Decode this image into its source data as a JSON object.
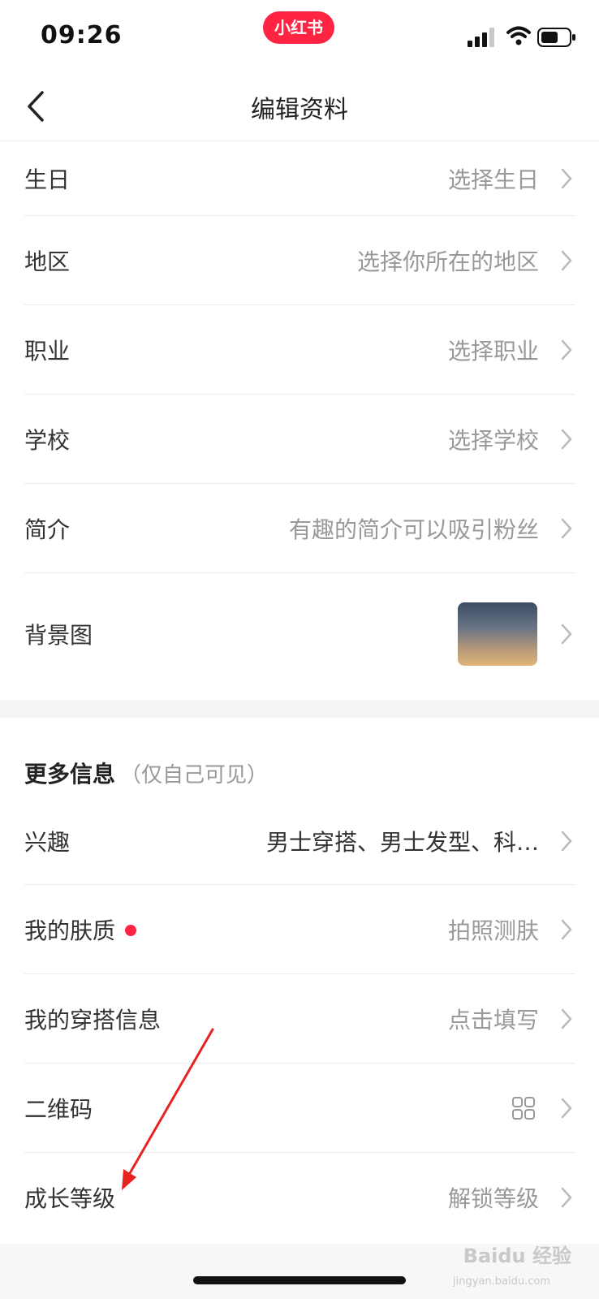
{
  "status_bar": {
    "time": "09:26",
    "app_badge": "小红书",
    "icons": [
      "signal-icon",
      "wifi-icon",
      "battery-icon"
    ]
  },
  "nav": {
    "title": "编辑资料",
    "back_icon": "back-icon"
  },
  "profile_rows": [
    {
      "label": "生日",
      "value": "选择生日"
    },
    {
      "label": "地区",
      "value": "选择你所在的地区"
    },
    {
      "label": "职业",
      "value": "选择职业"
    },
    {
      "label": "学校",
      "value": "选择学校"
    },
    {
      "label": "简介",
      "value": "有趣的简介可以吸引粉丝"
    },
    {
      "label": "背景图",
      "value": ""
    }
  ],
  "more_section": {
    "title": "更多信息",
    "note": "（仅自己可见）",
    "rows": [
      {
        "label": "兴趣",
        "value": "男士穿搭、男士发型、科…"
      },
      {
        "label": "我的肤质",
        "value": "拍照测肤",
        "has_red_dot": true
      },
      {
        "label": "我的穿搭信息",
        "value": "点击填写"
      },
      {
        "label": "二维码",
        "value": ""
      },
      {
        "label": "成长等级",
        "value": "解锁等级"
      }
    ]
  },
  "watermark": {
    "text": "Baidu 经验",
    "sub": "jingyan.baidu.com"
  },
  "colors": {
    "accent": "#ff2442",
    "annotation_arrow": "#e8231f",
    "value_gray": "#999999"
  }
}
